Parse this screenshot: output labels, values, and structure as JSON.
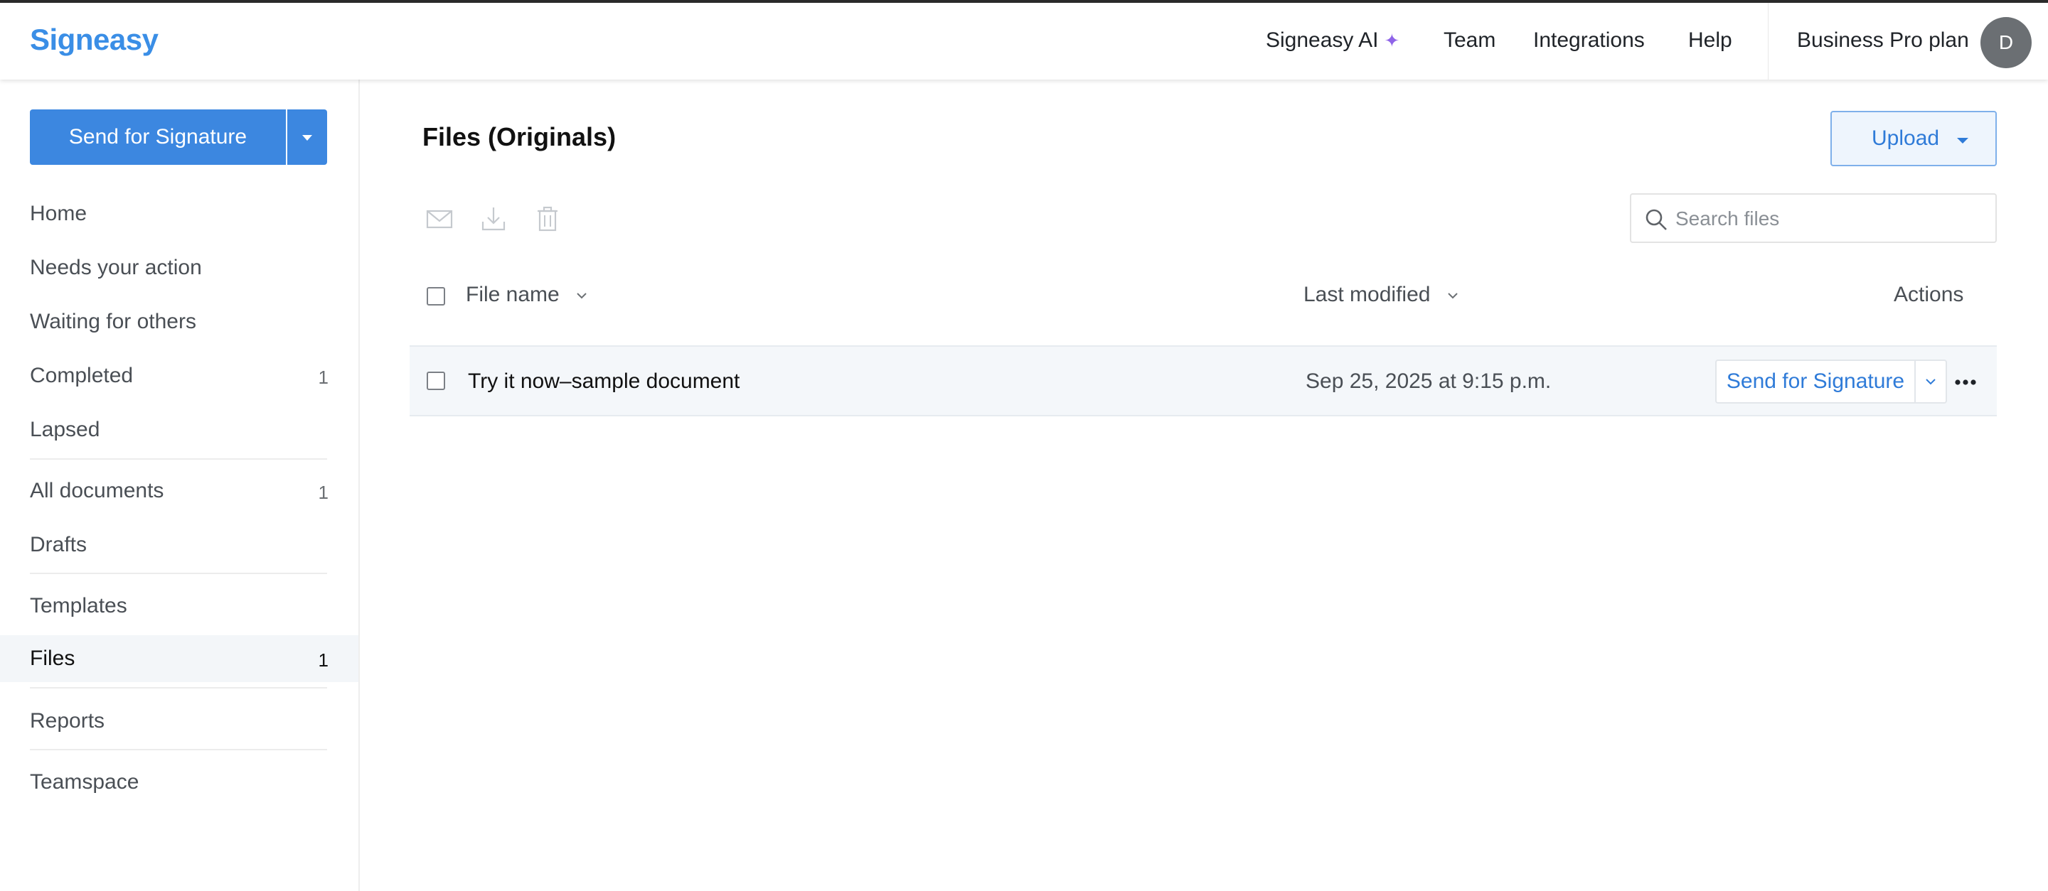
{
  "header": {
    "logo": "Signeasy",
    "nav": [
      {
        "label": "Signeasy AI",
        "icon": "sparkle-icon"
      },
      {
        "label": "Team"
      },
      {
        "label": "Integrations"
      },
      {
        "label": "Help"
      }
    ],
    "plan": "Business Pro plan",
    "avatar_initial": "D"
  },
  "sidebar": {
    "send_button": "Send for Signature",
    "items": [
      {
        "label": "Home"
      },
      {
        "label": "Needs your action"
      },
      {
        "label": "Waiting for others"
      },
      {
        "label": "Completed",
        "count": "1"
      },
      {
        "label": "Lapsed"
      },
      {
        "label": "All documents",
        "count": "1"
      },
      {
        "label": "Drafts"
      },
      {
        "label": "Templates"
      },
      {
        "label": "Files",
        "count": "1",
        "active": true
      },
      {
        "label": "Reports"
      },
      {
        "label": "Teamspace"
      }
    ]
  },
  "main": {
    "title": "Files (Originals)",
    "upload_label": "Upload",
    "toolbar_icons": [
      "mail-icon",
      "download-icon",
      "trash-icon"
    ],
    "search_placeholder": "Search files",
    "search_value": "",
    "columns": {
      "file_name": "File name",
      "last_modified": "Last modified",
      "actions": "Actions"
    },
    "rows": [
      {
        "name": "Try it now–sample document",
        "modified": "Sep 25, 2025 at 9:15 p.m.",
        "action": "Send for Signature"
      }
    ]
  },
  "colors": {
    "brand": "#3a8ee6",
    "primary_button": "#3c87e0",
    "link": "#2f7bd8",
    "sparkle": "#8f64e8",
    "active_row": "#f4f7fa"
  }
}
